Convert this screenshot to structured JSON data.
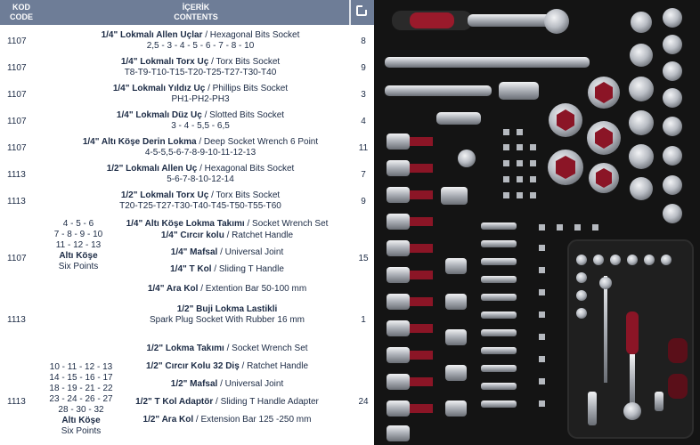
{
  "header": {
    "kod_line1": "KOD",
    "kod_line2": "CODE",
    "icerik_line1": "İÇERİK",
    "icerik_line2": "CONTENTS"
  },
  "rows": [
    {
      "kod": "1107",
      "title_bold": "1/4\" Lokmalı Allen Uçlar",
      "title_rest": " / Hexagonal Bits Socket",
      "sizes": "2,5 - 3 - 4 - 5 - 6 - 7 - 8 - 10",
      "qty": "8"
    },
    {
      "kod": "1107",
      "title_bold": "1/4\" Lokmalı Torx Uç",
      "title_rest": " / Torx Bits Socket",
      "sizes": "T8-T9-T10-T15-T20-T25-T27-T30-T40",
      "qty": "9"
    },
    {
      "kod": "1107",
      "title_bold": "1/4\" Lokmalı Yıldız Uç",
      "title_rest": " / Phillips  Bits Socket",
      "sizes": "PH1-PH2-PH3",
      "qty": "3"
    },
    {
      "kod": "1107",
      "title_bold": "1/4\" Lokmalı Düz Uç",
      "title_rest": " / Slotted  Bits Socket",
      "sizes": "3 - 4 - 5,5 - 6,5",
      "qty": "4"
    },
    {
      "kod": "1107",
      "title_bold": "1/4\" Altı Köşe Derin Lokma",
      "title_rest": " / Deep Socket Wrench 6 Point",
      "sizes": "4-5-5,5-6-7-8-9-10-11-12-13",
      "qty": "11"
    },
    {
      "kod": "1113",
      "title_bold": "1/2\" Lokmalı Allen Uç",
      "title_rest": " / Hexagonal Bits Socket",
      "sizes": "5-6-7-8-10-12-14",
      "qty": "7"
    },
    {
      "kod": "1113",
      "title_bold": "1/2\" Lokmalı Torx Uç",
      "title_rest": " / Torx Bits Socket",
      "sizes": "T20-T25-T27-T30-T40-T45-T50-T55-T60",
      "qty": "9"
    }
  ],
  "group1": {
    "kod": "1107",
    "qty": "15",
    "side_lines": [
      "4 - 5 - 6",
      "7 - 8 - 9 - 10",
      "11 - 12 - 13"
    ],
    "side_bold": "Altı Köşe",
    "side_last": "Six Points",
    "items": [
      {
        "bold": "1/4\" Altı Köşe Lokma Takımı",
        "rest": " / Socket Wrench Set"
      },
      {
        "bold": "1/4\" Cırcır kolu",
        "rest": " / Ratchet Handle"
      },
      {
        "bold": "1/4\" Mafsal",
        "rest": " / Universal Joint"
      },
      {
        "bold": "1/4\" T Kol",
        "rest": " / Sliding T Handle"
      },
      {
        "bold": "1/4\" Ara Kol",
        "rest": " / Extention Bar 50-100 mm"
      }
    ]
  },
  "spark": {
    "kod": "1113",
    "title_bold": "1/2\" Buji Lokma Lastikli",
    "sub": "Spark Plug Socket With Rubber 16 mm",
    "qty": "1"
  },
  "group2": {
    "kod": "1113",
    "qty": "24",
    "side_lines": [
      "10 - 11 - 12 - 13",
      "14 - 15 - 16 - 17",
      "18 - 19 - 21 - 22",
      "23 - 24 - 26 - 27",
      "28 - 30 - 32"
    ],
    "side_bold": "Altı Köşe",
    "side_last": "Six Points",
    "items": [
      {
        "bold": "1/2\" Lokma Takımı",
        "rest": " / Socket Wrench Set"
      },
      {
        "bold": "1/2\" Cırcır Kolu 32 Diş",
        "rest": " / Ratchet Handle"
      },
      {
        "bold": "1/2\" Mafsal",
        "rest": " / Universal Joint"
      },
      {
        "bold": "1/2\" T Kol Adaptör",
        "rest": " / Sliding T Handle Adapter"
      },
      {
        "bold": "1/2\" Ara Kol",
        "rest": " / Extension Bar 125 -250 mm"
      }
    ]
  },
  "colors": {
    "header_bg": "#6e7d97",
    "text": "#1b2a44",
    "tray": "#161616",
    "accent_red": "#8e1626",
    "metal": "#c9ccd1"
  }
}
